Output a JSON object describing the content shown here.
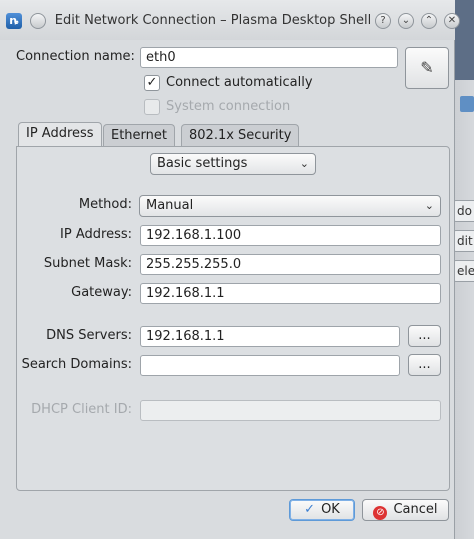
{
  "window": {
    "title": "Edit Network Connection – Plasma Desktop Shell",
    "app_icon_glyph": "ȵ",
    "help_glyph": "?",
    "minimize_glyph": "⌄",
    "maximize_glyph": "⌃",
    "close_glyph": "✕"
  },
  "connection": {
    "name_label": "Connection name:",
    "name_value": "eth0",
    "connect_auto_label": "Connect automatically",
    "connect_auto_checked": true,
    "system_connection_label": "System connection",
    "system_connection_checked": false,
    "pick_icon": "eyedropper-icon"
  },
  "tabs": [
    {
      "label": "IP Address",
      "active": true
    },
    {
      "label": "Ethernet",
      "active": false
    },
    {
      "label": "802.1x Security",
      "active": false
    }
  ],
  "settings_mode": {
    "value": "Basic settings"
  },
  "form": {
    "method_label": "Method:",
    "method_value": "Manual",
    "ip_label": "IP Address:",
    "ip_value": "192.168.1.100",
    "subnet_label": "Subnet Mask:",
    "subnet_value": "255.255.255.0",
    "gateway_label": "Gateway:",
    "gateway_value": "192.168.1.1",
    "dns_label": "DNS Servers:",
    "dns_value": "192.168.1.1",
    "dns_more": "...",
    "search_label": "Search Domains:",
    "search_value": "",
    "search_more": "...",
    "dhcp_label": "DHCP Client ID:",
    "dhcp_value": ""
  },
  "buttons": {
    "ok_label": "OK",
    "ok_glyph": "✓",
    "cancel_label": "Cancel",
    "cancel_glyph": "⊘"
  },
  "background_window": {
    "items": [
      "do",
      "dit",
      "ele"
    ]
  },
  "colors": {
    "dialog_bg": "#d9dcdf",
    "desktop_bg": "#5d6e86",
    "focus": "#5e9ad8"
  }
}
